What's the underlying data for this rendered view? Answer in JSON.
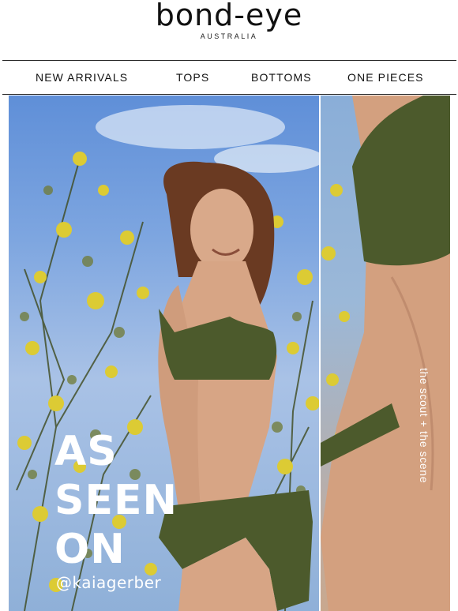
{
  "brand": {
    "name": "bond-eye",
    "subtitle": "AUSTRALIA"
  },
  "nav": {
    "items": [
      {
        "label": "NEW ARRIVALS"
      },
      {
        "label": "TOPS"
      },
      {
        "label": "BOTTOMS"
      },
      {
        "label": "ONE PIECES"
      }
    ]
  },
  "hero": {
    "headline_line1": "AS",
    "headline_line2": "SEEN",
    "headline_line3": "ON",
    "handle": "@kaiagerber",
    "side_caption": "the scout + the scene"
  },
  "colors": {
    "text": "#111111",
    "headline": "#ffffff",
    "swim": "#4c5a2c",
    "sky": "#7ea6e0",
    "foliage": "#d8c531"
  }
}
